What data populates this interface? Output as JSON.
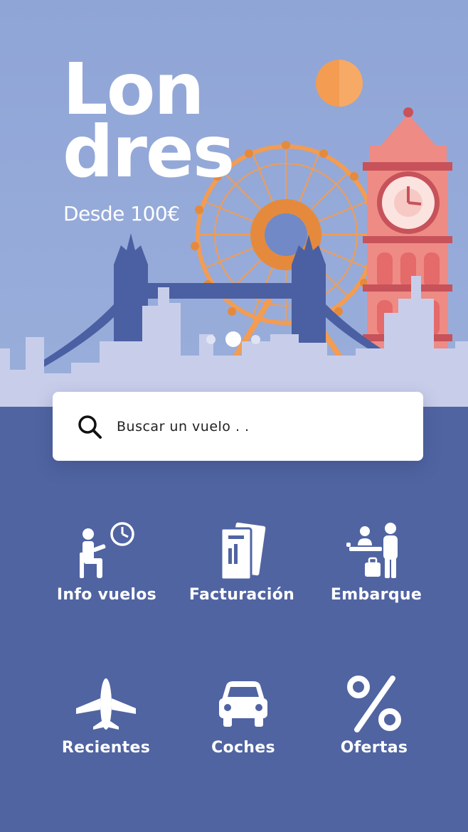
{
  "hero": {
    "title_line1": "Lon",
    "title_line2": "dres",
    "price": "Desde 100€",
    "carousel_pages": 3,
    "carousel_active": 2
  },
  "search": {
    "placeholder": "Buscar un vuelo . ."
  },
  "menu": [
    {
      "label": "Info vuelos",
      "icon": "flight-info-icon"
    },
    {
      "label": "Facturación",
      "icon": "boarding-pass-icon"
    },
    {
      "label": "Embarque",
      "icon": "boarding-desk-icon"
    },
    {
      "label": "Recientes",
      "icon": "airplane-icon"
    },
    {
      "label": "Coches",
      "icon": "car-icon"
    },
    {
      "label": "Ofertas",
      "icon": "percent-icon"
    }
  ],
  "colors": {
    "sky": "#8fa5d6",
    "panel": "#5064a2",
    "bridge": "#4b5fa3",
    "wheel": "#f39c52",
    "tower": "#ee8b84",
    "skyline": "#c8ceea"
  }
}
